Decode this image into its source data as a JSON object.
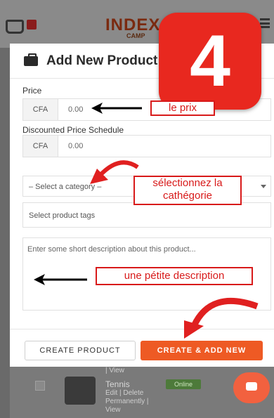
{
  "header": {
    "logo_text": "INDEX",
    "logo_sub": "CAMP"
  },
  "modal": {
    "title": "Add New Product",
    "price": {
      "label": "Price",
      "prefix": "CFA",
      "value": "0.00"
    },
    "discount": {
      "label": "Discounted Price Schedule",
      "prefix": "CFA",
      "value": "0.00"
    },
    "category": {
      "placeholder": "– Select a category –"
    },
    "tags": {
      "placeholder": "Select product tags"
    },
    "description": {
      "placeholder": "Enter some short description about this product..."
    },
    "buttons": {
      "create": "CREATE PRODUCT",
      "create_add": "CREATE & ADD NEW"
    }
  },
  "annotations": {
    "step": "4",
    "price_note": "le prix",
    "category_note_line1": "sélectionnez la",
    "category_note_line2": "cathégorie",
    "description_note": "une pétite description"
  },
  "background_list": {
    "view_link_top": "| View",
    "product_name": "Tennis",
    "links": "Edit | Delete Permanently | View",
    "status": "Online"
  },
  "colors": {
    "accent": "#ee5a24",
    "annotation_red": "#d81a1a"
  }
}
